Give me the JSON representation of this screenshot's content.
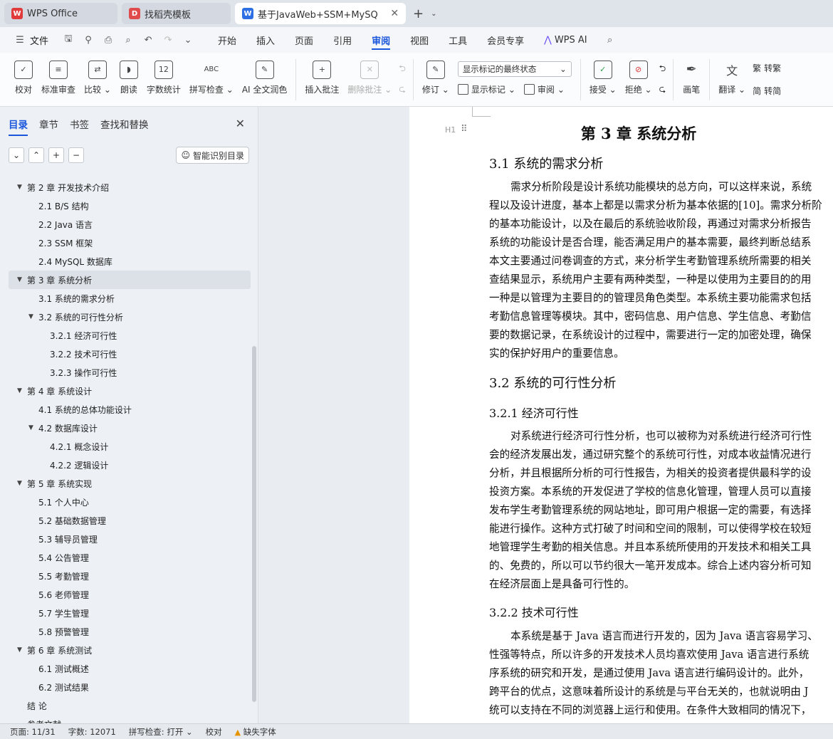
{
  "tabs": [
    {
      "label": "WPS Office",
      "color": "#e03a3a",
      "glyph": "W"
    },
    {
      "label": "找稻壳模板",
      "color": "#e04b4b",
      "glyph": "D"
    },
    {
      "label": "基于JavaWeb+SSM+MySQ",
      "color": "#2f6fe4",
      "glyph": "W",
      "active": true
    }
  ],
  "menu": {
    "file": "文件",
    "items": [
      "开始",
      "插入",
      "页面",
      "引用",
      "审阅",
      "视图",
      "工具",
      "会员专享"
    ],
    "active": "审阅",
    "ai": "WPS AI"
  },
  "ribbon": {
    "proofread": "校对",
    "standard_review": "标准审查",
    "compare": "比较",
    "read_aloud": "朗读",
    "word_count": "字数统计",
    "spell_check": "拼写检查",
    "ai_polish": "AI 全文润色",
    "insert_comment": "插入批注",
    "delete_comment": "删除批注",
    "revise": "修订",
    "markup_display": "显示标记的最终状态",
    "show_markup": "显示标记",
    "review": "审阅",
    "accept": "接受",
    "reject": "拒绝",
    "pen": "画笔",
    "translate": "翻译",
    "to_traditional": "转繁",
    "to_simplified": "转简",
    "word_count_icon_text": "12",
    "spell_icon_text": "ABC"
  },
  "nav": {
    "tabs": [
      "目录",
      "章节",
      "书签",
      "查找和替换"
    ],
    "smart_button": "智能识别目录",
    "toc": [
      {
        "level": 1,
        "label": "第 2 章  开发技术介绍",
        "expand": true
      },
      {
        "level": 2,
        "label": "2.1 B/S 结构"
      },
      {
        "level": 2,
        "label": "2.2 Java 语言"
      },
      {
        "level": 2,
        "label": "2.3 SSM 框架"
      },
      {
        "level": 2,
        "label": "2.4 MySQL 数据库"
      },
      {
        "level": 1,
        "label": "第 3 章  系统分析",
        "expand": true,
        "selected": true
      },
      {
        "level": 2,
        "label": "3.1 系统的需求分析"
      },
      {
        "level": 2,
        "label": "3.2 系统的可行性分析",
        "expand": true
      },
      {
        "level": 3,
        "label": "3.2.1 经济可行性"
      },
      {
        "level": 3,
        "label": "3.2.2 技术可行性"
      },
      {
        "level": 3,
        "label": "3.2.3 操作可行性"
      },
      {
        "level": 1,
        "label": "第 4 章  系统设计",
        "expand": true
      },
      {
        "level": 2,
        "label": "4.1 系统的总体功能设计"
      },
      {
        "level": 2,
        "label": "4.2 数据库设计",
        "expand": true
      },
      {
        "level": 3,
        "label": "4.2.1 概念设计"
      },
      {
        "level": 3,
        "label": "4.2.2 逻辑设计"
      },
      {
        "level": 1,
        "label": "第 5 章  系统实现",
        "expand": true
      },
      {
        "level": 2,
        "label": "5.1 个人中心"
      },
      {
        "level": 2,
        "label": "5.2 基础数据管理"
      },
      {
        "level": 2,
        "label": "5.3 辅导员管理"
      },
      {
        "level": 2,
        "label": "5.4 公告管理"
      },
      {
        "level": 2,
        "label": "5.5 考勤管理"
      },
      {
        "level": 2,
        "label": "5.6 老师管理"
      },
      {
        "level": 2,
        "label": "5.7 学生管理"
      },
      {
        "level": 2,
        "label": "5.8 预警管理"
      },
      {
        "level": 1,
        "label": "第 6 章   系统测试",
        "expand": true
      },
      {
        "level": 2,
        "label": "6.1    测试概述"
      },
      {
        "level": 2,
        "label": "6.2    测试结果"
      },
      {
        "level": 1,
        "label": "结     论"
      },
      {
        "level": 1,
        "label": "参考文献"
      }
    ]
  },
  "document": {
    "heading_marker": "H1",
    "chapter": "第 3 章  系统分析",
    "s31": "3.1 系统的需求分析",
    "s31_lines": [
      "需求分析阶段是设计系统功能模块的总方向，可以这样来说，系统",
      "程以及设计进度，基本上都是以需求分析为基本依据的[10]。需求分析阶",
      "的基本功能设计，以及在最后的系统验收阶段，再通过对需求分析报告",
      "系统的功能设计是否合理，能否满足用户的基本需要，最终判断总结系",
      "本文主要通过问卷调查的方式，来分析学生考勤管理系统所需要的相关",
      "查结果显示，系统用户主要有两种类型，一种是以使用为主要目的的用",
      "一种是以管理为主要目的的管理员角色类型。本系统主要功能需求包括",
      "考勤信息管理等模块。其中，密码信息、用户信息、学生信息、考勤信",
      "要的数据记录，在系统设计的过程中，需要进行一定的加密处理，确保",
      "实的保护好用户的重要信息。"
    ],
    "s32": "3.2 系统的可行性分析",
    "s321": "3.2.1 经济可行性",
    "s321_lines": [
      "对系统进行经济可行性分析，也可以被称为对系统进行经济可行性",
      "会的经济发展出发，通过研究整个的系统可行性，对成本收益情况进行",
      "分析，并且根据所分析的可行性报告，为相关的投资者提供最科学的设",
      "投资方案。本系统的开发促进了学校的信息化管理，管理人员可以直接",
      "发布学生考勤管理系统的网站地址，即可用户根据一定的需要，有选择",
      "能进行操作。这种方式打破了时间和空间的限制，可以使得学校在较短",
      "地管理学生考勤的相关信息。并且本系统所使用的开发技术和相关工具",
      "的、免费的，所以可以节约很大一笔开发成本。综合上述内容分析可知",
      "在经济层面上是具备可行性的。"
    ],
    "s322": "3.2.2 技术可行性",
    "s322_lines": [
      "本系统是基于 Java 语言而进行开发的，因为 Java 语言容易学习、",
      "性强等特点，所以许多的开发技术人员均喜欢使用 Java 语言进行系统",
      "序系统的研究和开发，是通过使用 Java 语言进行编码设计的。此外，",
      "跨平台的优点，这意味着所设计的系统是与平台无关的，也就说明由 J",
      "统可以支持在不同的浏览器上运行和使用。在条件大致相同的情况下，"
    ]
  },
  "status": {
    "page": "页面: 11/31",
    "words": "字数: 12071",
    "spell": "拼写检查: 打开",
    "proof": "校对",
    "missing_font": "缺失字体"
  }
}
